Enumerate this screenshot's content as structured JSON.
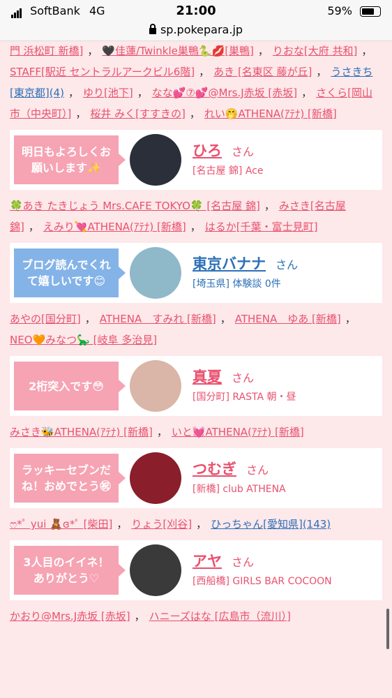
{
  "status": {
    "carrier": "SoftBank",
    "network": "4G",
    "time": "21:00",
    "battery": "59%",
    "url": "sp.pokepara.jp"
  },
  "links_1": [
    {
      "text": "門 浜松町 新橋]"
    },
    {
      "text": "🖤佳蓮/Twinkle巣鴨🐍💋[巣鴨]"
    },
    {
      "text": "りおな[大府 共和]"
    },
    {
      "text": "STAFF[駅近 セントラルアークビル6階]"
    },
    {
      "text": "あき [名東区 藤が丘]"
    },
    {
      "text": "うさきち[東京都](4)",
      "blue": true
    },
    {
      "text": "ゆり[池下]"
    },
    {
      "text": "なな💕⑦💕@Mrs.J赤坂 [赤坂]"
    },
    {
      "text": "さくら[岡山市（中央町）]"
    },
    {
      "text": "桜井 みく[すすきの]"
    },
    {
      "text": "れい🤭ATHENA(ｱﾃﾅ) [新橋]"
    }
  ],
  "cards": [
    {
      "message": "明日もよろしくお願いします✨",
      "name": "ひろ",
      "san": "さん",
      "sub": "[名古屋 錦] Ace",
      "blue": false,
      "avatar": "#2a2f3a"
    },
    {
      "message": "ブログ読んでくれて嬉しいです😊",
      "name": "東京バナナ",
      "san": "さん",
      "sub": "[埼玉県] 体験談 0件",
      "blue": true,
      "avatar": "#8fb8c9"
    },
    {
      "message": "2桁突入です😳",
      "name": "真夏",
      "san": "さん",
      "sub": "[国分町] RASTA 朝・昼",
      "blue": false,
      "avatar": "#d9b6a8"
    },
    {
      "message": "ラッキーセブンだね！おめでとう㊗",
      "name": "つむぎ",
      "san": "さん",
      "sub": "[新橋] club ATHENA",
      "blue": false,
      "avatar": "#8a1e2a"
    },
    {
      "message": "3人目のイイネ！ありがとう♡",
      "name": "アヤ",
      "san": "さん",
      "sub": "[西船橋] GIRLS BAR COCOON",
      "blue": false,
      "avatar": "#3a3a3a"
    }
  ],
  "links_2": [
    {
      "text": "🍀あき たきじょう Mrs.CAFE TOKYO🍀 [名古屋 錦]"
    },
    {
      "text": "みさき[名古屋 錦]"
    },
    {
      "text": "えみり💘ATHENA(ｱﾃﾅ) [新橋]"
    },
    {
      "text": "はるか[千葉・富士見町]"
    }
  ],
  "links_3": [
    {
      "text": "あやの[国分町]"
    },
    {
      "text": "ATHENA　すみれ [新橋]"
    },
    {
      "text": "ATHENA　ゆあ [新橋]"
    },
    {
      "text": "NEO🧡みなつ🦕 [岐阜 多治見]"
    }
  ],
  "links_4": [
    {
      "text": "みさき🐝ATHENA(ｱﾃﾅ) [新橋]"
    },
    {
      "text": "いと💓ATHENA(ｱﾃﾅ) [新橋]"
    }
  ],
  "links_5": [
    {
      "text": "ෆ*ﾟ yui 🧸ɞ*ﾟ [柴田]"
    },
    {
      "text": "りょう[刈谷]"
    },
    {
      "text": "ひっちゃん[愛知県](143)",
      "blue": true
    }
  ],
  "links_6": [
    {
      "text": "かおり@Mrs.J赤坂 [赤坂]"
    },
    {
      "text": "ハニーズはな [広島市（流川）]"
    }
  ],
  "sep": "，"
}
